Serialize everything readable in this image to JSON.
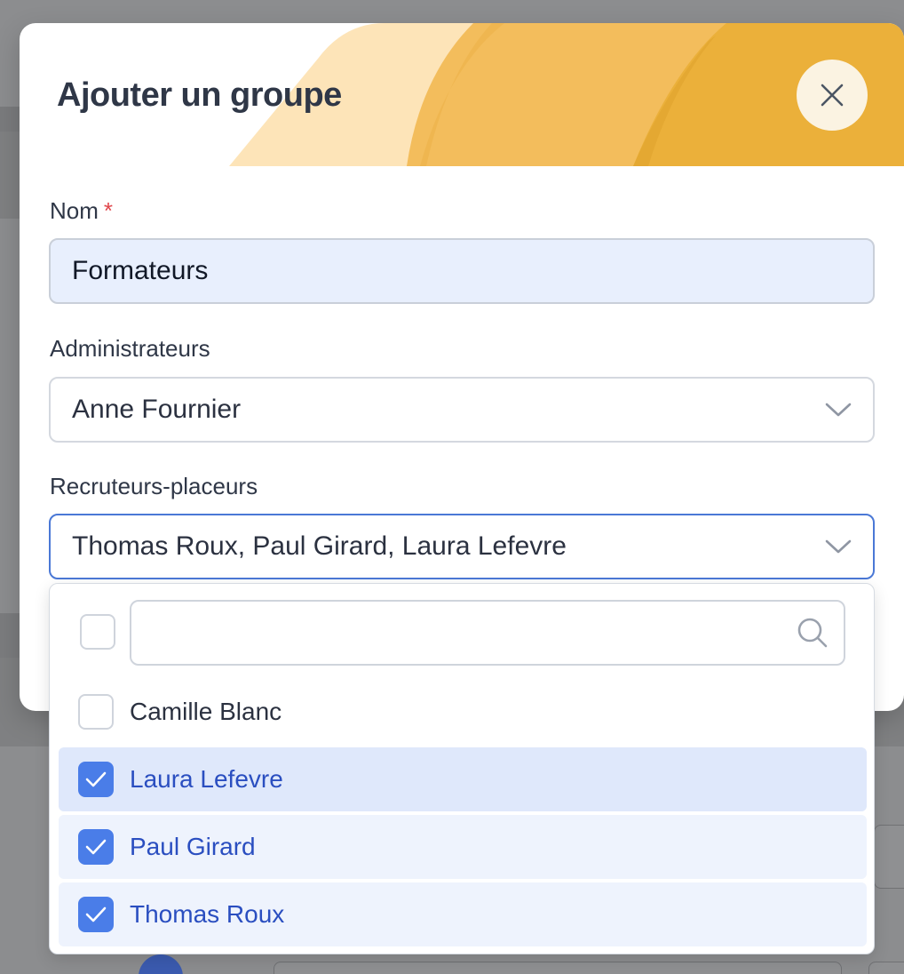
{
  "modal": {
    "title": "Ajouter un groupe"
  },
  "form": {
    "name": {
      "label": "Nom",
      "required_mark": "*",
      "value": "Formateurs"
    },
    "administrators": {
      "label": "Administrateurs",
      "value": "Anne Fournier"
    },
    "recruiters": {
      "label": "Recruteurs-placeurs",
      "value": "Thomas Roux, Paul Girard, Laura Lefevre"
    }
  },
  "dropdown": {
    "search_placeholder": "",
    "options": [
      {
        "label": "Camille Blanc",
        "checked": false
      },
      {
        "label": "Laura Lefevre",
        "checked": true
      },
      {
        "label": "Paul Girard",
        "checked": true
      },
      {
        "label": "Thomas Roux",
        "checked": true
      }
    ]
  },
  "colors": {
    "accent": "#4a7de8",
    "header_art_light": "#fde4b8",
    "header_art_mid": "#f3bd5c",
    "header_art_dark": "#ebb03a"
  },
  "icons": {
    "close": "close-icon",
    "chevron": "chevron-down-icon",
    "search": "search-icon",
    "check": "check-icon"
  }
}
